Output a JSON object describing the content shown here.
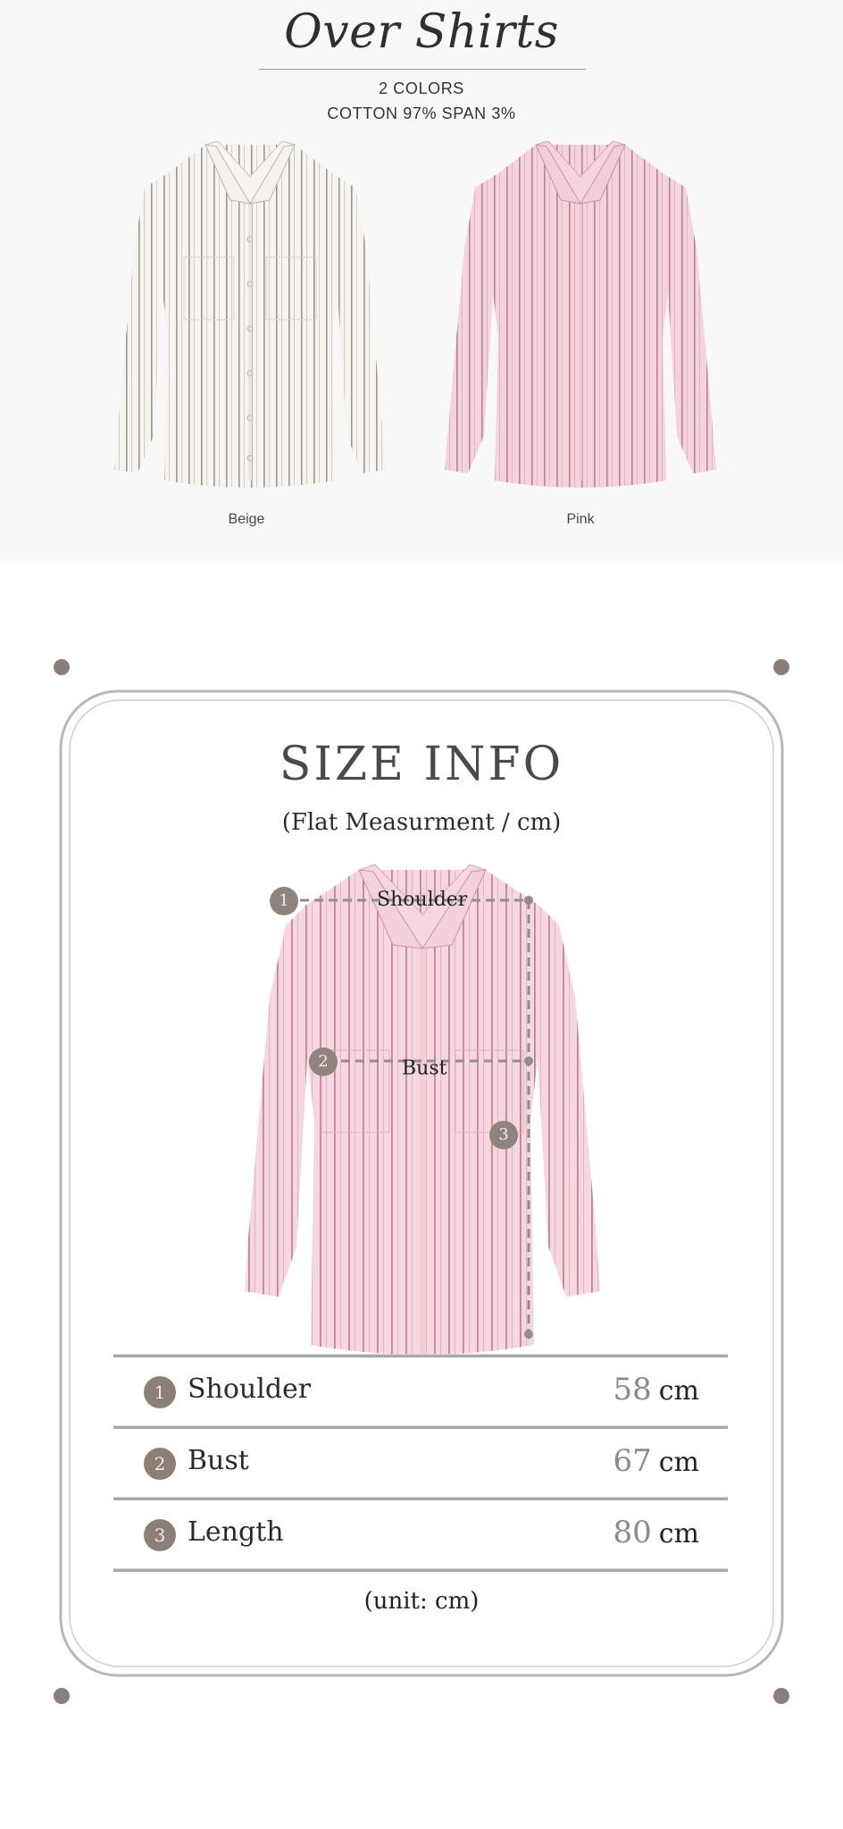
{
  "header": {
    "title": "Over Shirts",
    "colors_line": "2 COLORS",
    "fabric_line": "COTTON 97% SPAN 3%"
  },
  "variants": [
    {
      "label": "Beige",
      "base_color": "#f7f4ef",
      "stripe_color": "#9a9893"
    },
    {
      "label": "Pink",
      "base_color": "#f4d3dd",
      "stripe_color": "#b88392"
    }
  ],
  "size_info": {
    "title": "SIZE INFO",
    "subtitle": "(Flat Measurment / cm)",
    "diagram_labels": {
      "shoulder": "Shoulder",
      "bust": "Bust",
      "badge_1": "1",
      "badge_2": "2",
      "badge_3": "3"
    },
    "rows": [
      {
        "number": "1",
        "name": "Shoulder",
        "value": "58",
        "unit": "cm"
      },
      {
        "number": "2",
        "name": "Bust",
        "value": "67",
        "unit": "cm"
      },
      {
        "number": "3",
        "name": "Length",
        "value": "80",
        "unit": "cm"
      }
    ],
    "unit_note": "(unit: cm)"
  },
  "colors": {
    "badge": "#8d7f78",
    "frame": "#b9b6b3",
    "top_background": "#f8f8f8"
  }
}
